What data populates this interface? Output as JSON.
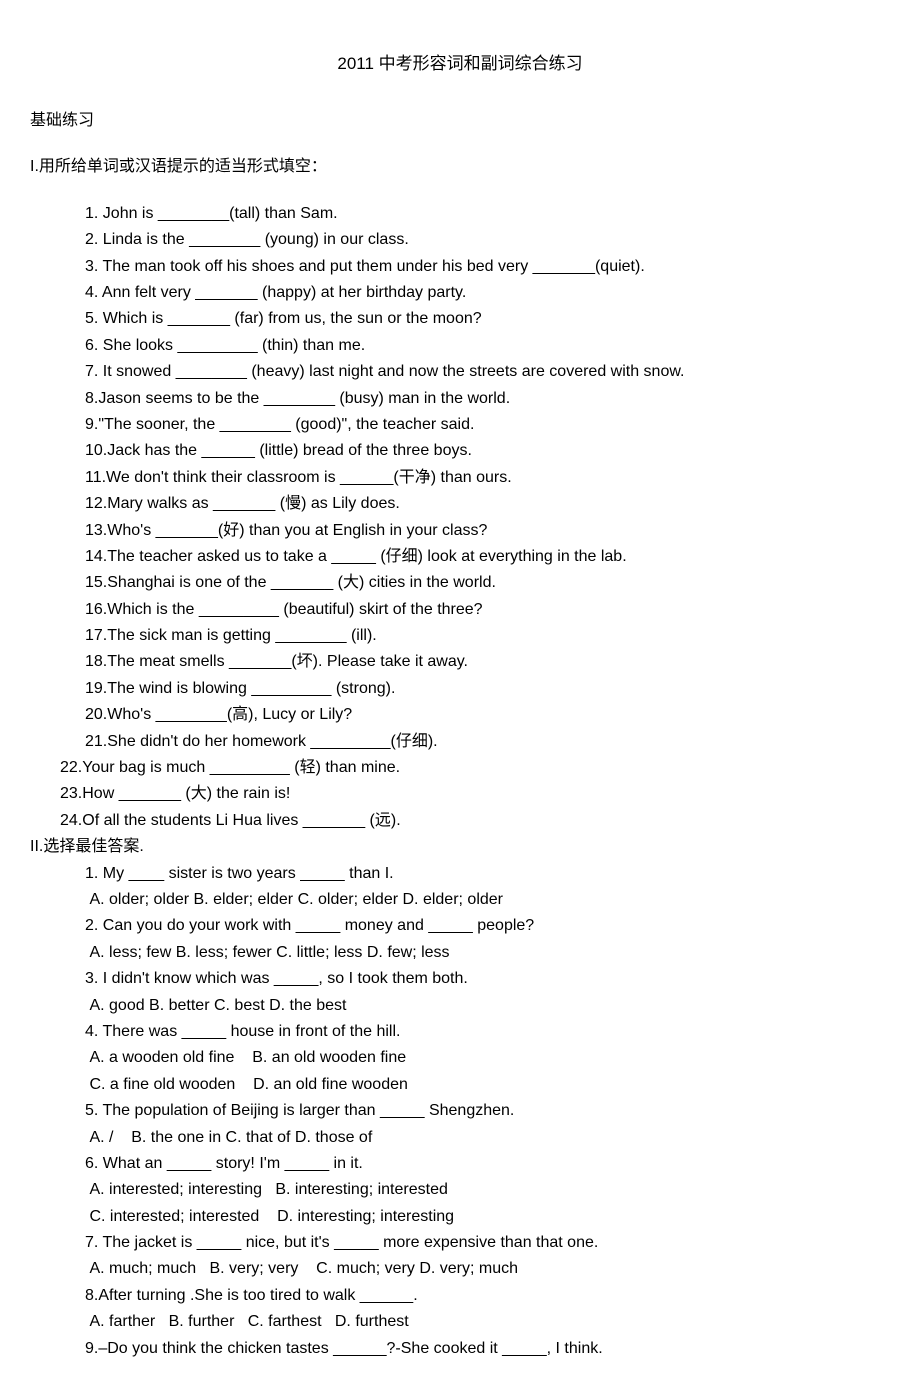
{
  "title": "2011 中考形容词和副词综合练习",
  "basic_heading": "基础练习",
  "section1_heading": "I.用所给单词或汉语提示的适当形式填空：",
  "section1": {
    "items": [
      "1. John is ________(tall) than Sam.",
      "2. Linda is the ________ (young) in our class.",
      "3. The man took off his shoes and put them under his bed very _______(quiet).",
      "4. Ann felt very _______ (happy) at her birthday party.",
      "5. Which is _______ (far) from us, the sun or the moon?",
      "6. She looks _________ (thin) than me.",
      "7. It snowed ________ (heavy) last night and now the streets are covered with snow.",
      "8.Jason seems to be the ________ (busy) man in the world.",
      "9.\"The sooner, the ________ (good)\", the teacher said.",
      "10.Jack has the ______ (little) bread of the three boys.",
      "11.We don't think their classroom is ______(干净) than ours.",
      "12.Mary walks as _______ (慢) as Lily does.",
      "13.Who's _______(好) than you at English in your class?",
      "14.The teacher asked us to take a _____ (仔细) look at everything in the lab.",
      "15.Shanghai is one of the _______ (大) cities in the world.",
      "16.Which is the _________ (beautiful) skirt of the three?",
      "17.The sick man is getting ________ (ill).",
      "18.The meat smells _______(坏). Please take it away.",
      "19.The wind is blowing _________ (strong).",
      "20.Who's ________(高), Lucy or Lily?",
      "21.She didn't do her homework _________(仔细)."
    ],
    "items_less_indent": [
      "22.Your bag is much _________ (轻) than mine.",
      "23.How _______ (大) the rain is!",
      "24.Of all the students Li Hua lives _______ (远)."
    ]
  },
  "section2_heading": "II.选择最佳答案.",
  "section2": {
    "items": [
      "1. My ____ sister is two years _____ than I.",
      " A. older; older B. elder; elder C. older; elder D. elder; older",
      "2. Can you do your work with _____ money and _____ people?",
      " A. less; few B. less; fewer C. little; less D. few; less",
      "3. I didn't know which was _____, so I took them both.",
      " A. good B. better C. best D. the best",
      "4. There was _____ house in front of the hill.",
      " A. a wooden old fine    B. an old wooden fine",
      " C. a fine old wooden    D. an old fine wooden",
      "5. The population of Beijing is larger than _____ Shengzhen.",
      " A. /    B. the one in C. that of D. those of",
      "6. What an _____ story! I'm _____ in it.",
      " A. interested; interesting   B. interesting; interested",
      " C. interested; interested    D. interesting; interesting",
      "7. The jacket is _____ nice, but it's _____ more expensive than that one.",
      " A. much; much   B. very; very    C. much; very D. very; much",
      "8.After turning .She is too tired to walk ______.",
      " A. farther   B. further   C. farthest   D. furthest",
      "9.–Do you think the chicken tastes ______?-She cooked it _____, I think."
    ]
  }
}
